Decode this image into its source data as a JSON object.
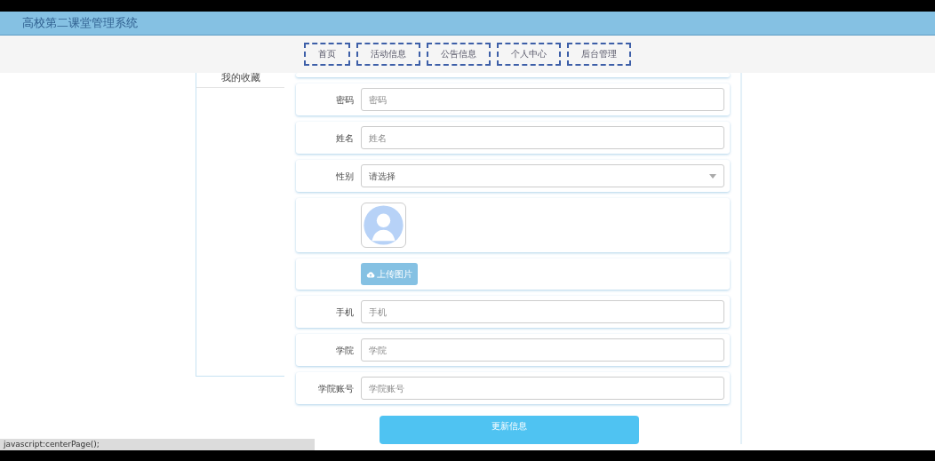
{
  "header": {
    "title": "高校第二课堂管理系统"
  },
  "nav": [
    {
      "label": "首页"
    },
    {
      "label": "活动信息"
    },
    {
      "label": "公告信息"
    },
    {
      "label": "个人中心"
    },
    {
      "label": "后台管理"
    }
  ],
  "sidebar": {
    "items": [
      {
        "label": "我的收藏"
      }
    ]
  },
  "form": {
    "fields": [
      {
        "kind": "text",
        "label": "密码",
        "placeholder": "密码"
      },
      {
        "kind": "text",
        "label": "姓名",
        "placeholder": "姓名"
      },
      {
        "kind": "select",
        "label": "性别",
        "value": "请选择"
      },
      {
        "kind": "avatar"
      },
      {
        "kind": "upload",
        "button": "上传图片"
      },
      {
        "kind": "text",
        "label": "手机",
        "placeholder": "手机"
      },
      {
        "kind": "text",
        "label": "学院",
        "placeholder": "学院"
      },
      {
        "kind": "text",
        "label": "学院账号",
        "placeholder": "学院账号"
      }
    ],
    "submit": "更新信息"
  },
  "status_bar": {
    "text": "javascript:centerPage();"
  }
}
